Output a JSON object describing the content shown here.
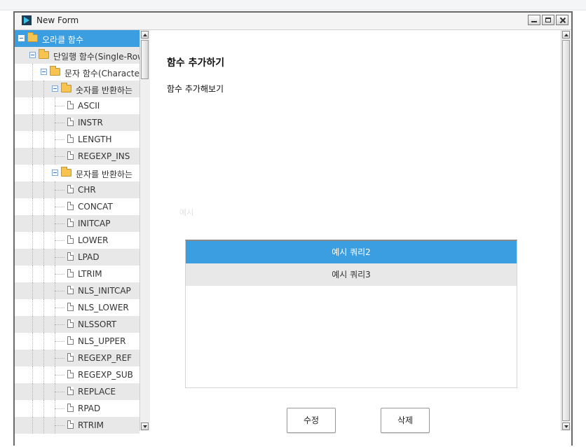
{
  "window": {
    "title": "New Form"
  },
  "tree": {
    "items": [
      {
        "label": "오라클 함수",
        "level": 0,
        "type": "folder",
        "selected": true
      },
      {
        "label": "단일행 함수(Single-Row",
        "level": 1,
        "type": "folder"
      },
      {
        "label": "문자 함수(Characte",
        "level": 2,
        "type": "folder"
      },
      {
        "label": "숫자를 반환하는",
        "level": 3,
        "type": "folder"
      },
      {
        "label": "ASCII",
        "level": 4,
        "type": "leaf"
      },
      {
        "label": "INSTR",
        "level": 4,
        "type": "leaf"
      },
      {
        "label": "LENGTH",
        "level": 4,
        "type": "leaf"
      },
      {
        "label": "REGEXP_INS",
        "level": 4,
        "type": "leaf"
      },
      {
        "label": "문자를 반환하는",
        "level": 3,
        "type": "folder"
      },
      {
        "label": "CHR",
        "level": 4,
        "type": "leaf"
      },
      {
        "label": "CONCAT",
        "level": 4,
        "type": "leaf"
      },
      {
        "label": "INITCAP",
        "level": 4,
        "type": "leaf"
      },
      {
        "label": "LOWER",
        "level": 4,
        "type": "leaf"
      },
      {
        "label": "LPAD",
        "level": 4,
        "type": "leaf"
      },
      {
        "label": "LTRIM",
        "level": 4,
        "type": "leaf"
      },
      {
        "label": "NLS_INITCAP",
        "level": 4,
        "type": "leaf"
      },
      {
        "label": "NLS_LOWER",
        "level": 4,
        "type": "leaf"
      },
      {
        "label": "NLSSORT",
        "level": 4,
        "type": "leaf"
      },
      {
        "label": "NLS_UPPER",
        "level": 4,
        "type": "leaf"
      },
      {
        "label": "REGEXP_REF",
        "level": 4,
        "type": "leaf"
      },
      {
        "label": "REGEXP_SUB",
        "level": 4,
        "type": "leaf"
      },
      {
        "label": "REPLACE",
        "level": 4,
        "type": "leaf"
      },
      {
        "label": "RPAD",
        "level": 4,
        "type": "leaf"
      },
      {
        "label": "RTRIM",
        "level": 4,
        "type": "leaf"
      }
    ]
  },
  "main": {
    "heading": "함수 추가하기",
    "subheading": "함수 추가해보기",
    "example_label": "예시",
    "queries": [
      {
        "label": "예시 쿼리2",
        "selected": true
      },
      {
        "label": "예시 쿼리3",
        "selected": false
      }
    ],
    "edit_button": "수정",
    "delete_button": "삭제"
  },
  "colors": {
    "selection": "#3a9ee0",
    "alt_row": "#e8e8e8"
  }
}
